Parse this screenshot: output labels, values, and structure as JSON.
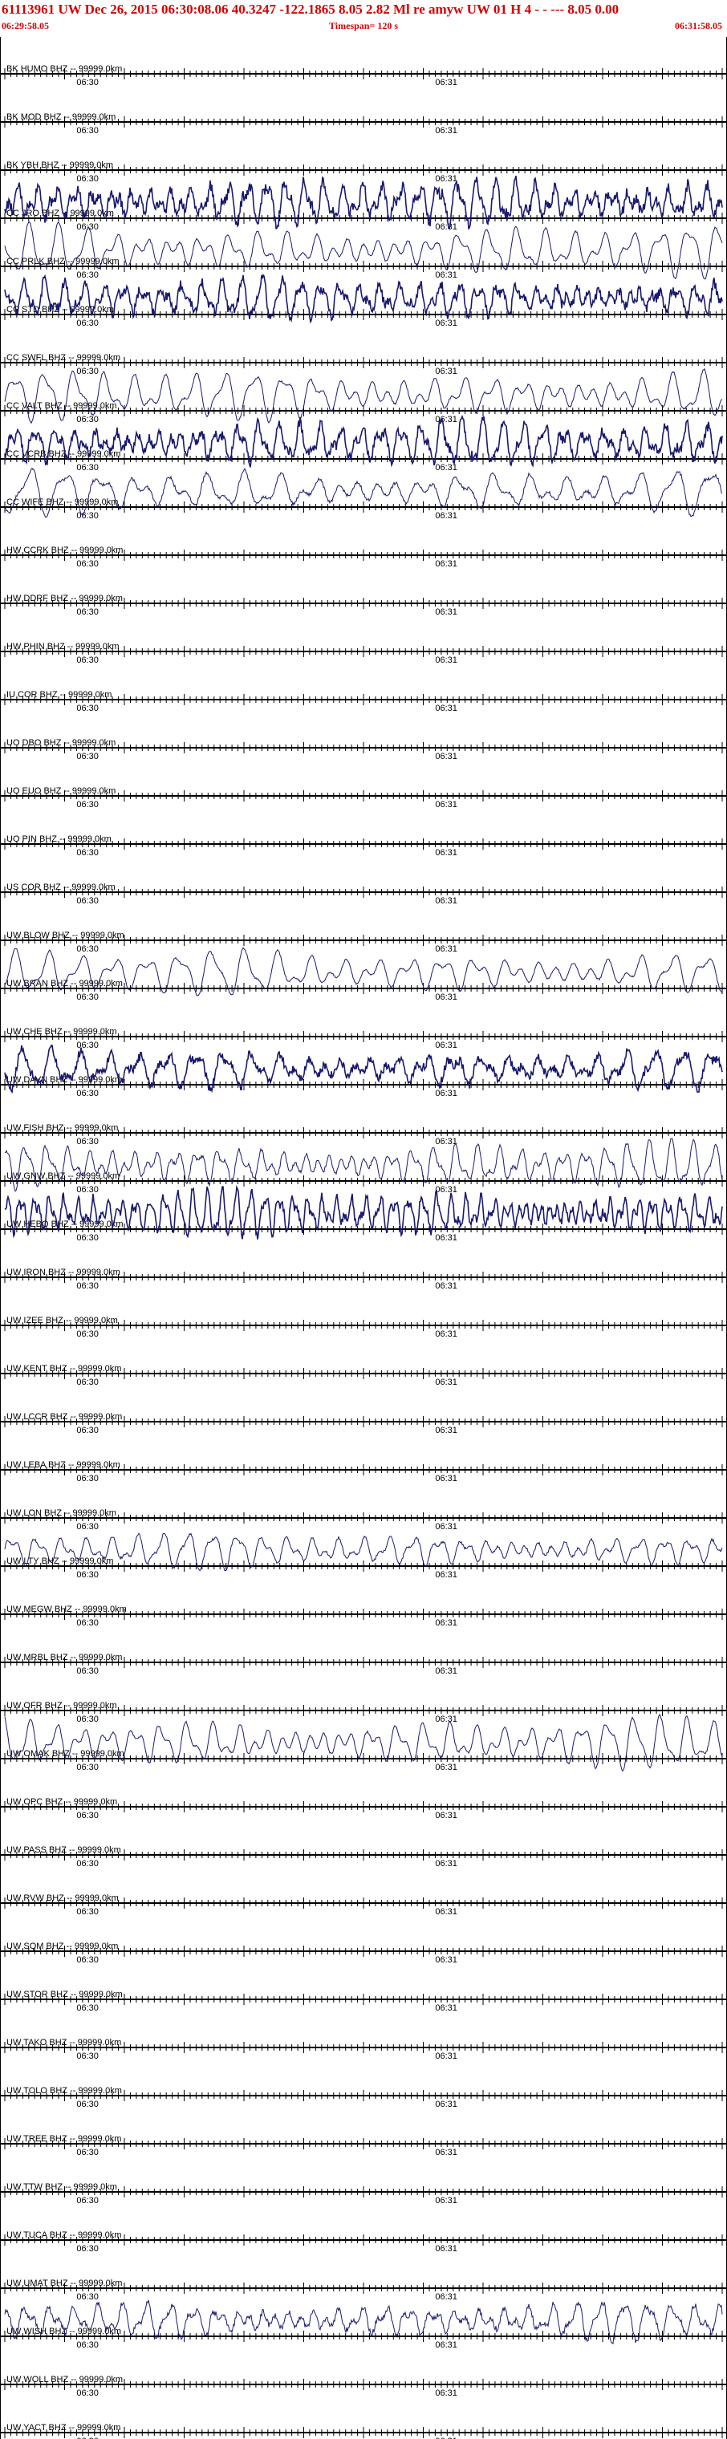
{
  "header": {
    "line1": "61113961 UW Dec 26, 2015 06:30:08.06    40.3247 -122.1865  8.05 2.82 Ml re    amyw     UW 01 H     4   -  - ---     8.05 0.00",
    "start_time": "06:29:58.05",
    "timespan": "Timespan= 120 s",
    "end_time": "06:31:58.05"
  },
  "colors": {
    "header_text": "#d40000",
    "trace": "#1a1a6e",
    "axis": "#000000"
  },
  "chart_data": {
    "type": "line",
    "title": "61113961 UW Dec 26, 2015 06:30:08.06",
    "xlabel": "",
    "ylabel": "",
    "timespan_s": 120,
    "start_time": "06:29:58.05",
    "end_time": "06:31:58.05",
    "tick_labels": [
      "06:30",
      "06:31"
    ],
    "stations": [
      {
        "label": "BK HUMO BHZ -- 99999.0km",
        "signal": 0,
        "period": 0,
        "noise": 0
      },
      {
        "label": "BK MOD BHZ -- 99999.0km",
        "signal": 0,
        "period": 0,
        "noise": 0
      },
      {
        "label": "BK YBH BHZ -- 99999.0km",
        "signal": 0,
        "period": 0,
        "noise": 0
      },
      {
        "label": "CC JRO BHZ -- 99999.0km",
        "signal": 0.9,
        "period": 3.2,
        "noise": 0.35
      },
      {
        "label": "CC PRLK BHZ -- 99999.0km",
        "signal": 1.0,
        "period": 4.8,
        "noise": 0.05
      },
      {
        "label": "CC STD BHZ -- 99999.0km",
        "signal": 0.8,
        "period": 3.3,
        "noise": 0.35
      },
      {
        "label": "CC SWFL BHZ -- 99999.0km",
        "signal": 0,
        "period": 0,
        "noise": 0
      },
      {
        "label": "CC VALT BHZ -- 99999.0km",
        "signal": 1.0,
        "period": 5.0,
        "noise": 0.05
      },
      {
        "label": "CC VCRB BHZ -- 99999.0km",
        "signal": 0.9,
        "period": 3.4,
        "noise": 0.3
      },
      {
        "label": "CC WIFE BHZ -- 99999.0km",
        "signal": 0.9,
        "period": 6.0,
        "noise": 0.1
      },
      {
        "label": "HW CCRK BHZ -- 99999.0km",
        "signal": 0,
        "period": 0,
        "noise": 0
      },
      {
        "label": "HW DDRF BHZ -- 99999.0km",
        "signal": 0,
        "period": 0,
        "noise": 0
      },
      {
        "label": "HW PHIN BHZ -- 99999.0km",
        "signal": 0,
        "period": 0,
        "noise": 0
      },
      {
        "label": "IU COR BHZ -- 99999.0km",
        "signal": 0,
        "period": 0,
        "noise": 0
      },
      {
        "label": "UO DBO BHZ -- 99999.0km",
        "signal": 0,
        "period": 0,
        "noise": 0
      },
      {
        "label": "UO EUO BHZ -- 99999.0km",
        "signal": 0,
        "period": 0,
        "noise": 0
      },
      {
        "label": "UO PIN BHZ -- 99999.0km",
        "signal": 0,
        "period": 0,
        "noise": 0
      },
      {
        "label": "US COR BHZ -- 99999.0km",
        "signal": 0,
        "period": 0,
        "noise": 0
      },
      {
        "label": "UW BLOW BHZ -- 99999.0km",
        "signal": 0,
        "period": 0,
        "noise": 0
      },
      {
        "label": "UW BRAN BHZ -- 99999.0km",
        "signal": 0.9,
        "period": 5.5,
        "noise": 0.05
      },
      {
        "label": "UW CHE BHZ -- 99999.0km",
        "signal": 0,
        "period": 0,
        "noise": 0
      },
      {
        "label": "UW DAVN BHZ -- 99999.0km",
        "signal": 0.8,
        "period": 4.8,
        "noise": 0.3
      },
      {
        "label": "UW FISH BHZ -- 99999.0km",
        "signal": 0,
        "period": 0,
        "noise": 0
      },
      {
        "label": "UW GNW BHZ -- 99999.0km",
        "signal": 0.9,
        "period": 3.6,
        "noise": 0.1
      },
      {
        "label": "UW HEBO BHZ -- 99999.0km",
        "signal": 0.9,
        "period": 2.4,
        "noise": 0.25
      },
      {
        "label": "UW IRON BHZ -- 99999.0km",
        "signal": 0,
        "period": 0,
        "noise": 0
      },
      {
        "label": "UW IZEE BHZ -- 99999.0km",
        "signal": 0,
        "period": 0,
        "noise": 0
      },
      {
        "label": "UW KENT BHZ -- 99999.0km",
        "signal": 0,
        "period": 0,
        "noise": 0
      },
      {
        "label": "UW LCCR BHZ -- 99999.0km",
        "signal": 0,
        "period": 0,
        "noise": 0
      },
      {
        "label": "UW LEBA BHZ -- 99999.0km",
        "signal": 0,
        "period": 0,
        "noise": 0
      },
      {
        "label": "UW LON BHZ -- 99999.0km",
        "signal": 0,
        "period": 0,
        "noise": 0
      },
      {
        "label": "UW LTY BHZ -- 99999.0km",
        "signal": 0.7,
        "period": 4.2,
        "noise": 0.1
      },
      {
        "label": "UW MEGW BHZ -- 99999.0km",
        "signal": 0,
        "period": 0,
        "noise": 0
      },
      {
        "label": "UW MRBL BHZ -- 99999.0km",
        "signal": 0,
        "period": 0,
        "noise": 0
      },
      {
        "label": "UW OFR BHZ -- 99999.0km",
        "signal": 0,
        "period": 0,
        "noise": 0
      },
      {
        "label": "UW OMAK BHZ -- 99999.0km",
        "signal": 1.0,
        "period": 4.4,
        "noise": 0.05
      },
      {
        "label": "UW OPC BHZ -- 99999.0km",
        "signal": 0,
        "period": 0,
        "noise": 0
      },
      {
        "label": "UW PASS BHZ -- 99999.0km",
        "signal": 0,
        "period": 0,
        "noise": 0
      },
      {
        "label": "UW RVW BHZ -- 99999.0km",
        "signal": 0,
        "period": 0,
        "noise": 0
      },
      {
        "label": "UW SQM BHZ -- 99999.0km",
        "signal": 0,
        "period": 0,
        "noise": 0
      },
      {
        "label": "UW STOR BHZ -- 99999.0km",
        "signal": 0,
        "period": 0,
        "noise": 0
      },
      {
        "label": "UW TAKO BHZ -- 99999.0km",
        "signal": 0,
        "period": 0,
        "noise": 0
      },
      {
        "label": "UW TOLO BHZ -- 99999.0km",
        "signal": 0,
        "period": 0,
        "noise": 0
      },
      {
        "label": "UW TREE BHZ -- 99999.0km",
        "signal": 0,
        "period": 0,
        "noise": 0
      },
      {
        "label": "UW TTW BHZ -- 99999.0km",
        "signal": 0,
        "period": 0,
        "noise": 0
      },
      {
        "label": "UW TUCA BHZ -- 99999.0km",
        "signal": 0,
        "period": 0,
        "noise": 0
      },
      {
        "label": "UW UMAT BHZ -- 99999.0km",
        "signal": 0,
        "period": 0,
        "noise": 0
      },
      {
        "label": "UW WISH BHZ -- 99999.0km",
        "signal": 0.8,
        "period": 4.0,
        "noise": 0.2
      },
      {
        "label": "UW WOLL BHZ -- 99999.0km",
        "signal": 0,
        "period": 0,
        "noise": 0
      },
      {
        "label": "UW YACT BHZ -- 99999.0km",
        "signal": 0,
        "period": 0,
        "noise": 0
      }
    ]
  }
}
